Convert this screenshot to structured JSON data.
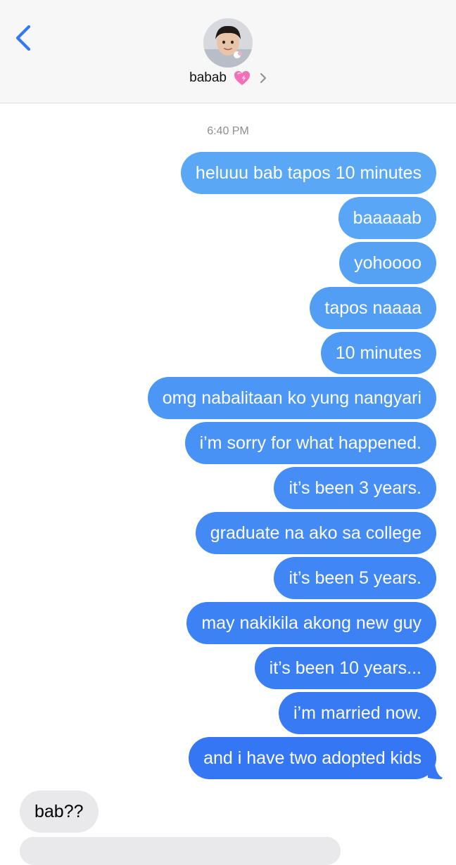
{
  "header": {
    "back_icon": "chevron-left-icon",
    "avatar_icon": "contact-photo",
    "contact_name": "babab",
    "contact_emoji": "💗",
    "disclosure_icon": "chevron-right-icon"
  },
  "thread": {
    "timestamp": "6:40 PM",
    "sent_messages": [
      {
        "text": "heluuu bab tapos 10 minutes",
        "color": "#5aa8f5"
      },
      {
        "text": "baaaaab",
        "color": "#58a6f5"
      },
      {
        "text": "yohoooo",
        "color": "#55a2f5"
      },
      {
        "text": "tapos naaaa",
        "color": "#529ef5"
      },
      {
        "text": "10 minutes",
        "color": "#4f9af5"
      },
      {
        "text": "omg nabalitaan ko yung nangyari",
        "color": "#4c96f5"
      },
      {
        "text": "i’m sorry for what happened.",
        "color": "#4992f5"
      },
      {
        "text": "it’s been 3 years.",
        "color": "#468ef5"
      },
      {
        "text": "graduate na ako sa college",
        "color": "#438af5"
      },
      {
        "text": "it’s been 5 years.",
        "color": "#4086f4"
      },
      {
        "text": "may nakikila akong new guy",
        "color": "#3d82f4"
      },
      {
        "text": "it’s been 10 years...",
        "color": "#3a7ef4"
      },
      {
        "text": "i’m married now.",
        "color": "#377af3"
      },
      {
        "text": "and i have two adopted kids",
        "color": "#3476f3"
      }
    ],
    "received_messages": [
      {
        "text": "bab??"
      }
    ]
  },
  "colors": {
    "ios_blue": "#3478f6",
    "received_bubble": "#e9e9eb",
    "header_bg": "#f7f7f8"
  }
}
